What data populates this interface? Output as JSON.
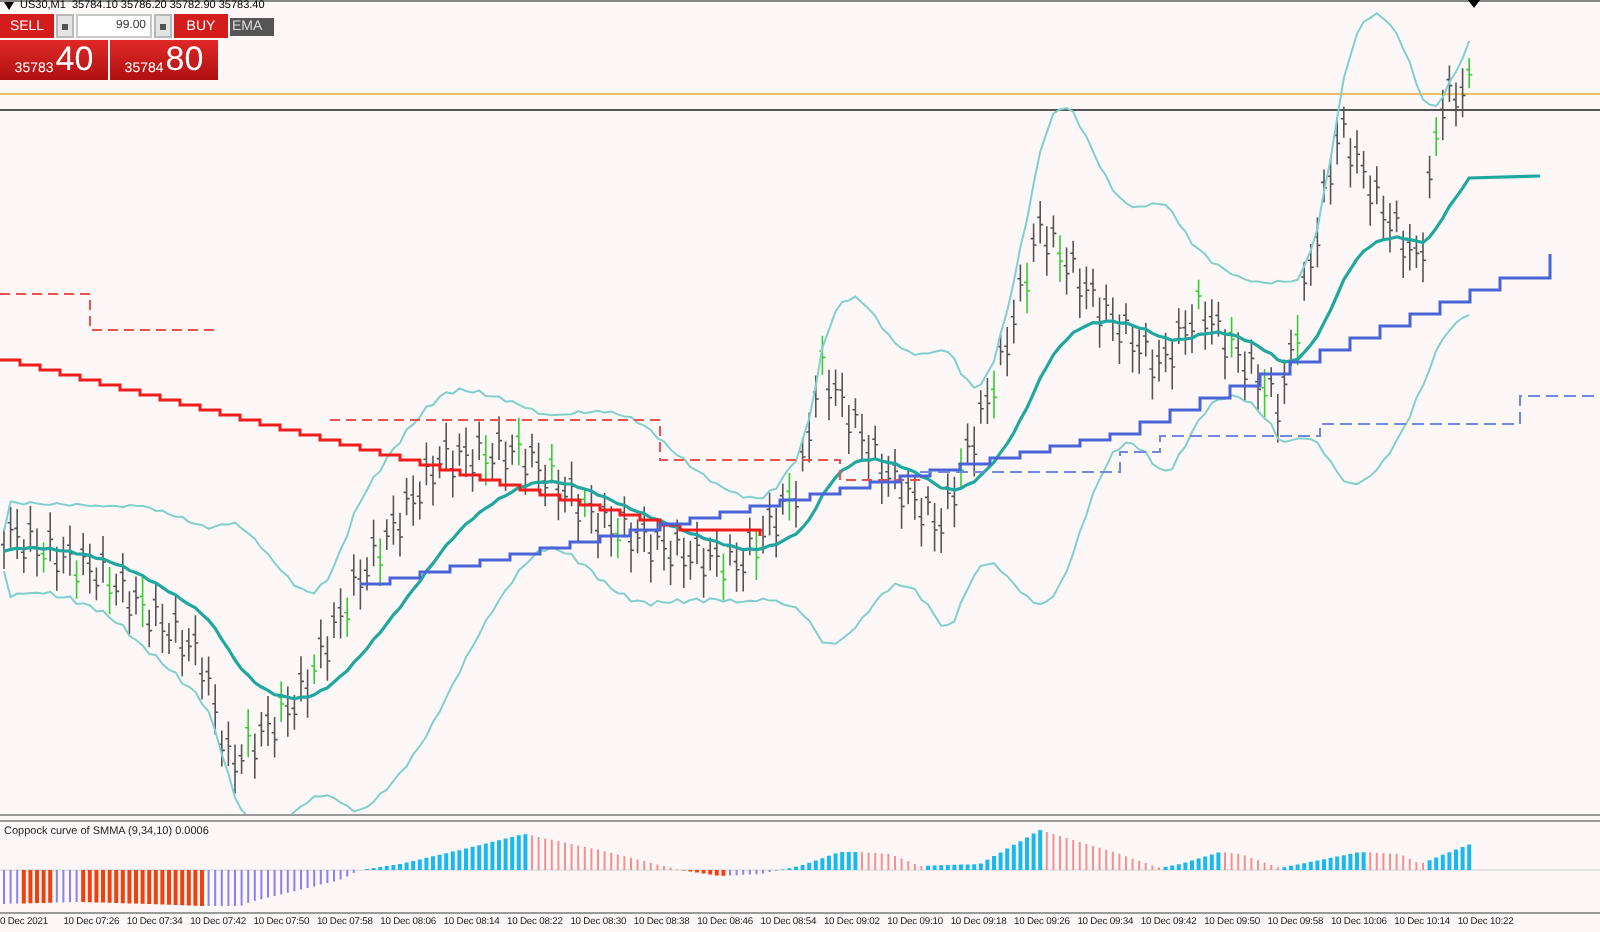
{
  "chart_header": {
    "symbol": "US30,M1",
    "prices": [
      "35784.10",
      "35786.20",
      "35782.90",
      "35783.40"
    ]
  },
  "trade_panel": {
    "sell_label": "SELL",
    "buy_label": "BUY",
    "volume": "99.00",
    "sell_price": {
      "main": "35783",
      "big": "40"
    },
    "buy_price": {
      "main": "35784",
      "big": "80"
    }
  },
  "indicator_tag": "EMA",
  "indicator_pane": {
    "title": "Coppock curve of SMMA (9,34,10) 0.0006"
  },
  "time_axis": {
    "labels": [
      "0 Dec 2021",
      "10 Dec 07:26",
      "10 Dec 07:34",
      "10 Dec 07:42",
      "10 Dec 07:50",
      "10 Dec 07:58",
      "10 Dec 08:06",
      "10 Dec 08:14",
      "10 Dec 08:22",
      "10 Dec 08:30",
      "10 Dec 08:38",
      "10 Dec 08:46",
      "10 Dec 08:54",
      "10 Dec 09:02",
      "10 Dec 09:10",
      "10 Dec 09:18",
      "10 Dec 09:26",
      "10 Dec 09:34",
      "10 Dec 09:42",
      "10 Dec 09:50",
      "10 Dec 09:58",
      "10 Dec 10:06",
      "10 Dec 10:14",
      "10 Dec 10:22"
    ]
  }
}
